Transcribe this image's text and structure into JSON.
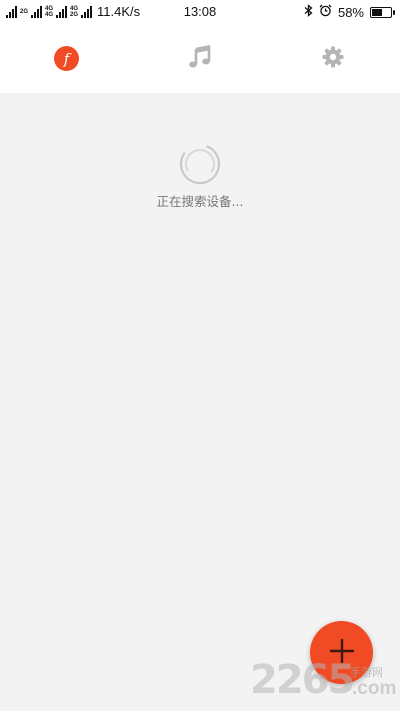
{
  "status_bar": {
    "network_left": "2G",
    "network_mid_top": "4G",
    "network_mid_bottom": "4G",
    "network_right_top": "4G",
    "network_right_bottom": "2G",
    "speed": "11.4K/s",
    "time": "13:08",
    "battery_percent": "58%",
    "battery_level": 0.58
  },
  "tabs": [
    {
      "id": "device",
      "icon": "f-logo-icon",
      "label": "f",
      "active": true
    },
    {
      "id": "music",
      "icon": "music-note-icon",
      "active": false
    },
    {
      "id": "settings",
      "icon": "gear-icon",
      "active": false
    }
  ],
  "main": {
    "loading_text": "正在搜索设备..."
  },
  "fab": {
    "icon": "plus-icon"
  },
  "watermark": {
    "number": "2265",
    "cn_text": "手游网",
    "com_text": ".com"
  },
  "colors": {
    "accent": "#f04b24",
    "inactive_icon": "#b5b5b5",
    "background": "#f3f3f3"
  }
}
